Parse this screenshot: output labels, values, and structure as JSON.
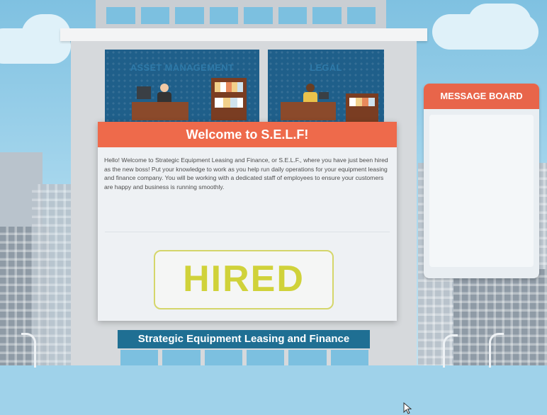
{
  "rooms": [
    {
      "label": "ASSET MANAGEMENT"
    },
    {
      "label": "LEGAL"
    }
  ],
  "message_board": {
    "title": "MESSAGE BOARD"
  },
  "dialog": {
    "title": "Welcome to S.E.L.F!",
    "body": "Hello! Welcome to Strategic Equipment Leasing and Finance, or S.E.L.F., where you have just been hired as the new boss! Put your knowledge to work as you help run daily operations for your equipment leasing and finance company. You will be working with a dedicated staff of employees to ensure your customers are happy and business is running smoothly.",
    "button_label": "HIRED"
  },
  "building_sign": {
    "label": "Strategic Equipment Leasing and Finance"
  },
  "colors": {
    "accent_orange": "#ee6a4b",
    "button_yellow": "#d0d23a",
    "sign_blue": "#1f6f93",
    "room_blue": "#1f5f8a"
  }
}
